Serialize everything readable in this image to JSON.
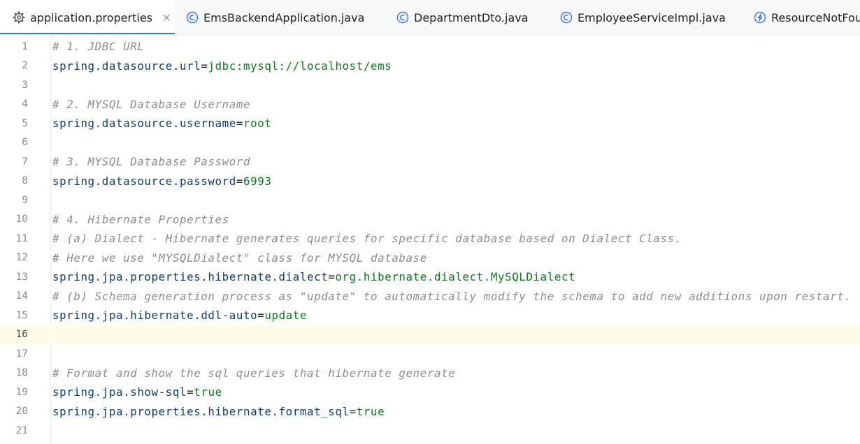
{
  "tabs": [
    {
      "label": "application.properties",
      "icon": "gear-icon",
      "active": true,
      "close": "×"
    },
    {
      "label": "EmsBackendApplication.java",
      "icon": "class-icon"
    },
    {
      "label": "DepartmentDto.java",
      "icon": "class-icon"
    },
    {
      "label": "EmployeeServiceImpl.java",
      "icon": "class-icon"
    },
    {
      "label": "ResourceNotFou",
      "icon": "exception-icon"
    }
  ],
  "editor": {
    "current_line": 16,
    "colors": {
      "comment": "#8c8c8c",
      "key": "#0b3a7a",
      "value": "#067d17",
      "current_line_bg": "#fefbe9",
      "active_tab_underline": "#3574f0",
      "class_icon": "#3574f0"
    },
    "lines": [
      {
        "num": "1",
        "comment": "# 1. JDBC URL"
      },
      {
        "num": "2",
        "key": "spring.datasource.url",
        "eq": "=",
        "value": "jdbc:mysql://localhost/ems"
      },
      {
        "num": "3"
      },
      {
        "num": "4",
        "comment": "# 2. MYSQL Database Username"
      },
      {
        "num": "5",
        "key": "spring.datasource.username",
        "eq": "=",
        "value": "root"
      },
      {
        "num": "6"
      },
      {
        "num": "7",
        "comment": "# 3. MYSQL Database Password"
      },
      {
        "num": "8",
        "key": "spring.datasource.password",
        "eq": "=",
        "value": "6993"
      },
      {
        "num": "9"
      },
      {
        "num": "10",
        "comment": "# 4. Hibernate Properties"
      },
      {
        "num": "11",
        "comment": "# (a) Dialect - Hibernate generates queries for specific database based on Dialect Class."
      },
      {
        "num": "12",
        "comment": "# Here we use \"MYSQLDialect\" class for MYSQL database"
      },
      {
        "num": "13",
        "key": "spring.jpa.properties.hibernate.dialect",
        "eq": "=",
        "value": "org.hibernate.dialect.MySQLDialect"
      },
      {
        "num": "14",
        "comment": "# (b) Schema generation process as \"update\" to automatically modify the schema to add new additions upon restart."
      },
      {
        "num": "15",
        "key": "spring.jpa.hibernate.ddl-auto",
        "eq": "=",
        "value": "update"
      },
      {
        "num": "16"
      },
      {
        "num": "17"
      },
      {
        "num": "18",
        "comment": "# Format and show the sql queries that hibernate generate"
      },
      {
        "num": "19",
        "key": "spring.jpa.show-sql",
        "eq": "=",
        "value": "true"
      },
      {
        "num": "20",
        "key": "spring.jpa.properties.hibernate.format_sql",
        "eq": "=",
        "value": "true"
      },
      {
        "num": "21"
      }
    ]
  }
}
